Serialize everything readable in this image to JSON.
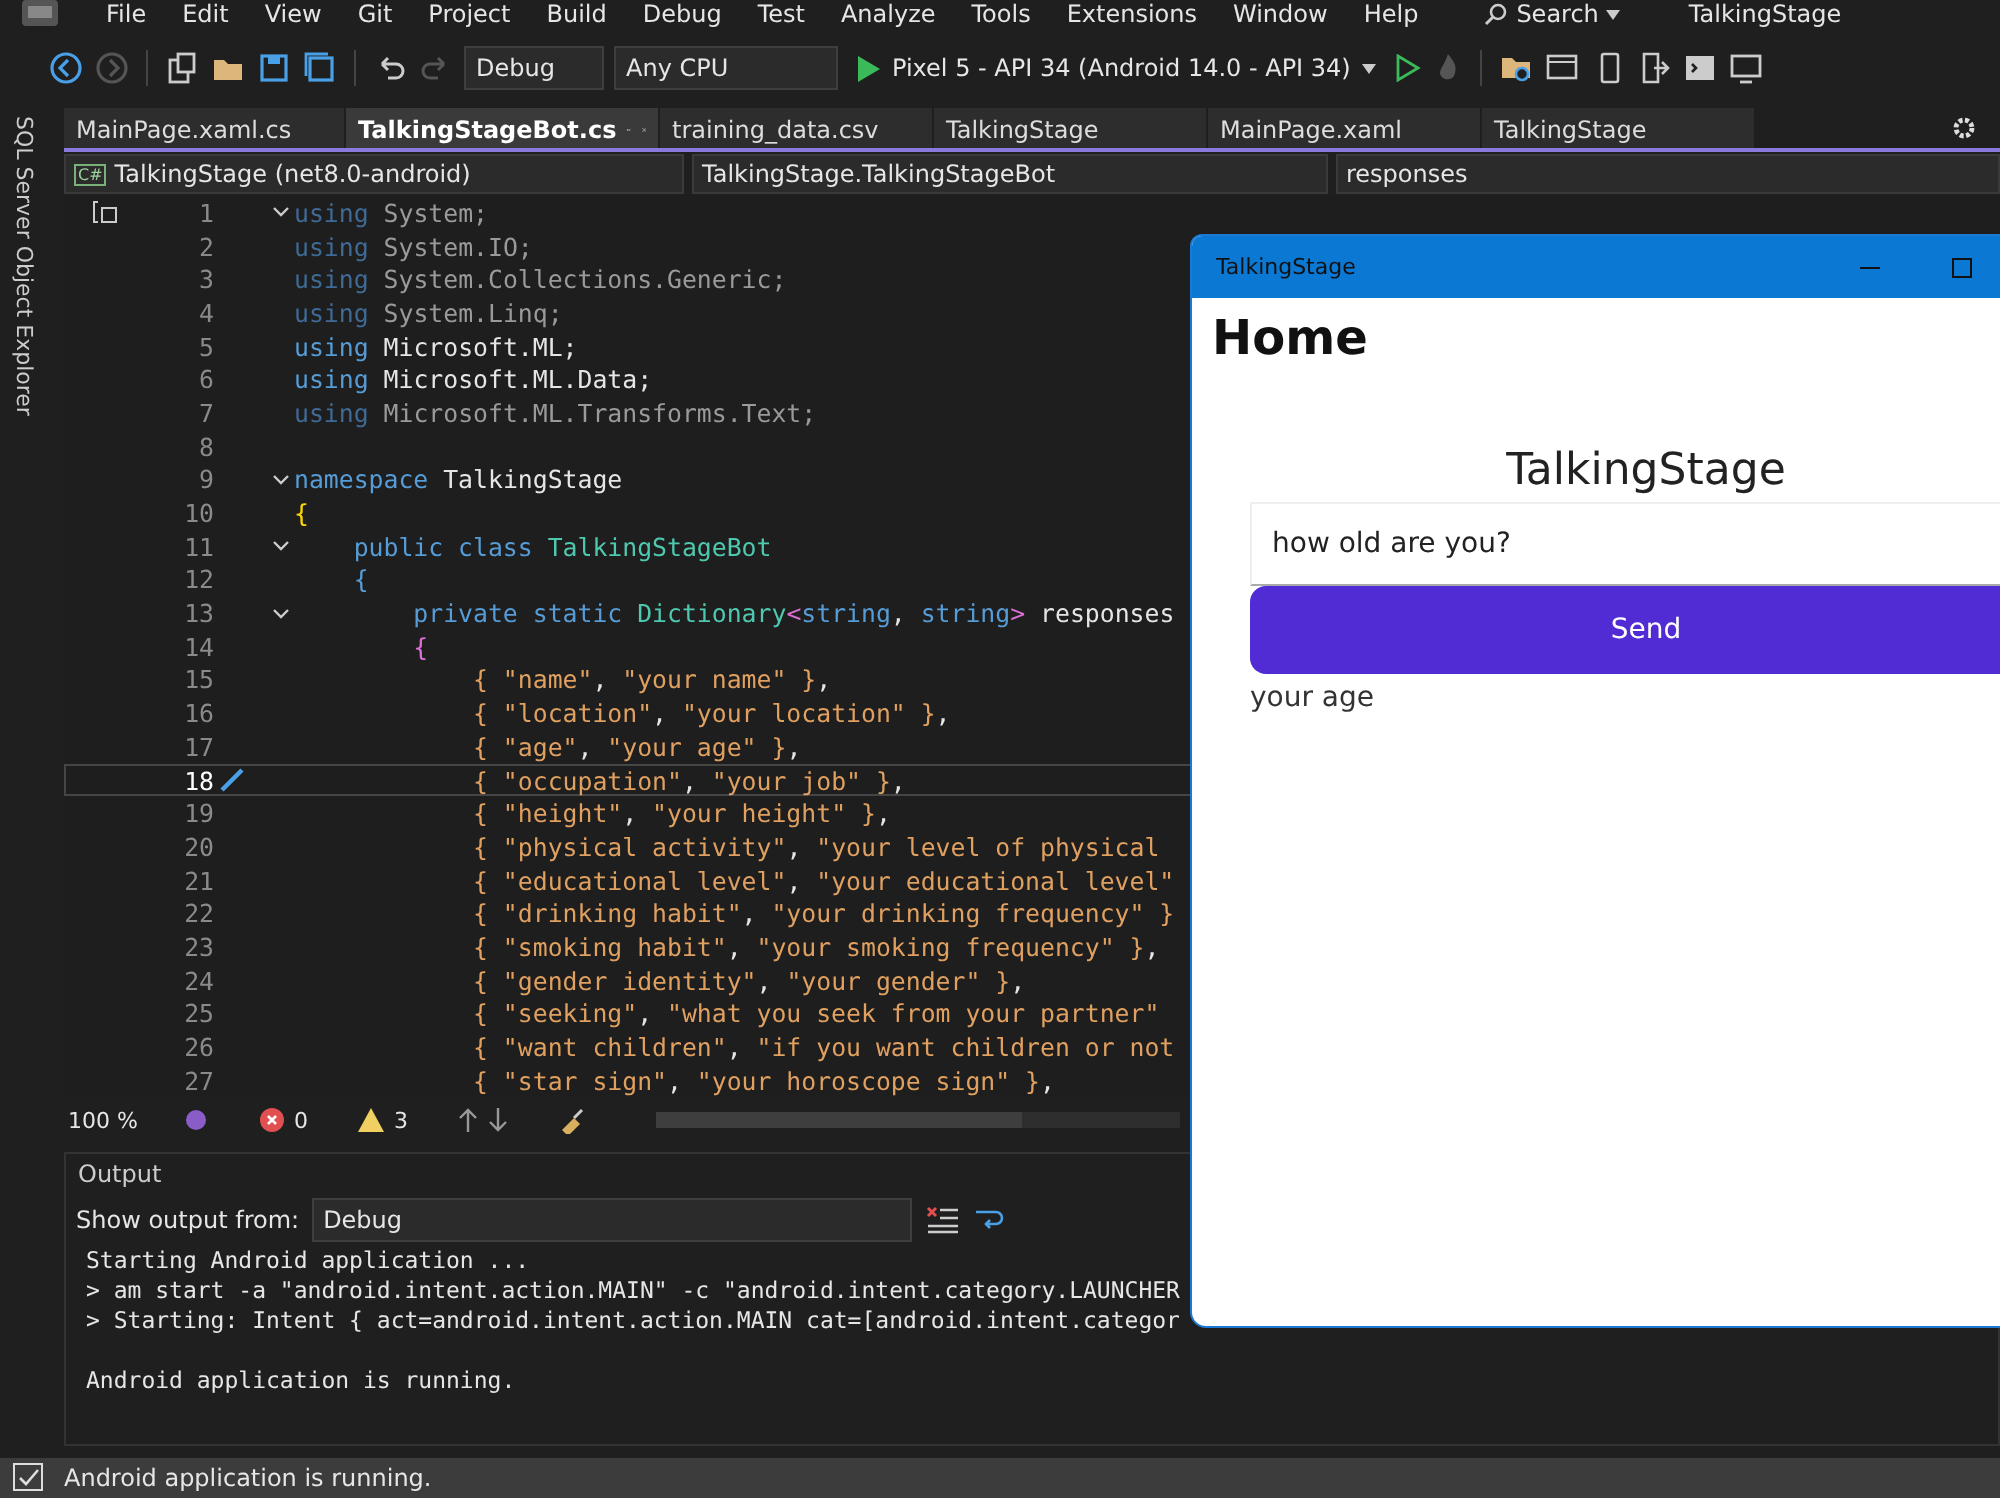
{
  "menu": [
    "File",
    "Edit",
    "View",
    "Git",
    "Project",
    "Build",
    "Debug",
    "Test",
    "Analyze",
    "Tools",
    "Extensions",
    "Window",
    "Help"
  ],
  "search": "Search",
  "solution_title": "TalkingStage",
  "toolbar": {
    "configuration": "Debug",
    "platform": "Any CPU",
    "run_target": "Pixel 5 - API 34 (Android 14.0 - API 34)"
  },
  "side_strip": "SQL Server Object Explorer",
  "tabs": [
    {
      "label": "MainPage.xaml.cs",
      "selected": false
    },
    {
      "label": "TalkingStageBot.cs",
      "selected": true
    },
    {
      "label": "training_data.csv",
      "selected": false
    },
    {
      "label": "TalkingStage",
      "selected": false
    },
    {
      "label": "MainPage.xaml",
      "selected": false
    },
    {
      "label": "TalkingStage",
      "selected": false
    }
  ],
  "nav_bar": {
    "project_icon_text": "C#",
    "project": "TalkingStage (net8.0-android)",
    "type": "TalkingStage.TalkingStageBot",
    "member": "responses"
  },
  "code_lines": [
    {
      "number": "1",
      "fold": true,
      "current": false,
      "tokens": [
        {
          "kind": "kwdim",
          "text": "using"
        },
        {
          "kind": "dim",
          "text": " System;"
        }
      ]
    },
    {
      "number": "2",
      "fold": false,
      "current": false,
      "tokens": [
        {
          "kind": "kwdim",
          "text": "using"
        },
        {
          "kind": "dim",
          "text": " System.IO;"
        }
      ]
    },
    {
      "number": "3",
      "fold": false,
      "current": false,
      "tokens": [
        {
          "kind": "kwdim",
          "text": "using"
        },
        {
          "kind": "dim",
          "text": " System.Collections.Generic;"
        }
      ]
    },
    {
      "number": "4",
      "fold": false,
      "current": false,
      "tokens": [
        {
          "kind": "kwdim",
          "text": "using"
        },
        {
          "kind": "dim",
          "text": " System.Linq;"
        }
      ]
    },
    {
      "number": "5",
      "fold": false,
      "current": false,
      "tokens": [
        {
          "kind": "kw",
          "text": "using"
        },
        {
          "kind": "plain",
          "text": " Microsoft.ML;"
        }
      ]
    },
    {
      "number": "6",
      "fold": false,
      "current": false,
      "tokens": [
        {
          "kind": "kw",
          "text": "using"
        },
        {
          "kind": "plain",
          "text": " Microsoft.ML.Data;"
        }
      ]
    },
    {
      "number": "7",
      "fold": false,
      "current": false,
      "tokens": [
        {
          "kind": "kwdim",
          "text": "using"
        },
        {
          "kind": "dim",
          "text": " Microsoft.ML.Transforms.Text;"
        }
      ]
    },
    {
      "number": "8",
      "fold": false,
      "current": false
    },
    {
      "number": "9",
      "fold": true,
      "current": false,
      "tokens": [
        {
          "kind": "kw",
          "text": "namespace"
        },
        {
          "kind": "plain",
          "text": " TalkingStage"
        }
      ]
    },
    {
      "number": "10",
      "fold": false,
      "current": false,
      "tokens": [
        {
          "kind": "brace1",
          "text": "{"
        }
      ]
    },
    {
      "number": "11",
      "fold": true,
      "current": false,
      "tokens": [
        {
          "kind": "kw",
          "text": "    public class"
        },
        {
          "kind": "type",
          "text": " TalkingStageBot"
        }
      ]
    },
    {
      "number": "12",
      "fold": false,
      "current": false,
      "tokens": [
        {
          "kind": "kw",
          "text": "    {"
        }
      ]
    },
    {
      "number": "13",
      "fold": true,
      "current": false,
      "tokens": [
        {
          "kind": "kw",
          "text": "        private static"
        },
        {
          "kind": "type",
          "text": " Dictionary"
        },
        {
          "kind": "brace3",
          "text": "<"
        },
        {
          "kind": "kw",
          "text": "string"
        },
        {
          "kind": "plain",
          "text": ", "
        },
        {
          "kind": "kw",
          "text": "string"
        },
        {
          "kind": "brace3",
          "text": ">"
        },
        {
          "kind": "plain",
          "text": " responses"
        }
      ]
    },
    {
      "number": "14",
      "fold": false,
      "current": false,
      "tokens": [
        {
          "kind": "brace3",
          "text": "        {"
        }
      ]
    },
    {
      "number": "15",
      "fold": false,
      "current": false,
      "tokens": [
        {
          "kind": "str",
          "text": "            { \"name\""
        },
        {
          "kind": "plain",
          "text": ", "
        },
        {
          "kind": "str",
          "text": "\"your name\" }"
        },
        {
          "kind": "plain",
          "text": ","
        }
      ]
    },
    {
      "number": "16",
      "fold": false,
      "current": false,
      "tokens": [
        {
          "kind": "str",
          "text": "            { \"location\""
        },
        {
          "kind": "plain",
          "text": ", "
        },
        {
          "kind": "str",
          "text": "\"your location\" }"
        },
        {
          "kind": "plain",
          "text": ","
        }
      ]
    },
    {
      "number": "17",
      "fold": false,
      "current": false,
      "tokens": [
        {
          "kind": "str",
          "text": "            { \"age\""
        },
        {
          "kind": "plain",
          "text": ", "
        },
        {
          "kind": "str",
          "text": "\"your age\" }"
        },
        {
          "kind": "plain",
          "text": ","
        }
      ]
    },
    {
      "number": "18",
      "fold": false,
      "current": true,
      "tokens": [
        {
          "kind": "str",
          "text": "            { \"occupation\""
        },
        {
          "kind": "plain",
          "text": ", "
        },
        {
          "kind": "str",
          "text": "\"your job\" }"
        },
        {
          "kind": "plain",
          "text": ","
        }
      ]
    },
    {
      "number": "19",
      "fold": false,
      "current": false,
      "tokens": [
        {
          "kind": "str",
          "text": "            { \"height\""
        },
        {
          "kind": "plain",
          "text": ", "
        },
        {
          "kind": "str",
          "text": "\"your height\" }"
        },
        {
          "kind": "plain",
          "text": ","
        }
      ]
    },
    {
      "number": "20",
      "fold": false,
      "current": false,
      "tokens": [
        {
          "kind": "str",
          "text": "            { \"physical activity\""
        },
        {
          "kind": "plain",
          "text": ", "
        },
        {
          "kind": "str",
          "text": "\"your level of physical"
        }
      ]
    },
    {
      "number": "21",
      "fold": false,
      "current": false,
      "tokens": [
        {
          "kind": "str",
          "text": "            { \"educational level\""
        },
        {
          "kind": "plain",
          "text": ", "
        },
        {
          "kind": "str",
          "text": "\"your educational level\""
        }
      ]
    },
    {
      "number": "22",
      "fold": false,
      "current": false,
      "tokens": [
        {
          "kind": "str",
          "text": "            { \"drinking habit\""
        },
        {
          "kind": "plain",
          "text": ", "
        },
        {
          "kind": "str",
          "text": "\"your drinking frequency\" }"
        }
      ]
    },
    {
      "number": "23",
      "fold": false,
      "current": false,
      "tokens": [
        {
          "kind": "str",
          "text": "            { \"smoking habit\""
        },
        {
          "kind": "plain",
          "text": ", "
        },
        {
          "kind": "str",
          "text": "\"your smoking frequency\" }"
        },
        {
          "kind": "plain",
          "text": ","
        }
      ]
    },
    {
      "number": "24",
      "fold": false,
      "current": false,
      "tokens": [
        {
          "kind": "str",
          "text": "            { \"gender identity\""
        },
        {
          "kind": "plain",
          "text": ", "
        },
        {
          "kind": "str",
          "text": "\"your gender\" }"
        },
        {
          "kind": "plain",
          "text": ","
        }
      ]
    },
    {
      "number": "25",
      "fold": false,
      "current": false,
      "tokens": [
        {
          "kind": "str",
          "text": "            { \"seeking\""
        },
        {
          "kind": "plain",
          "text": ", "
        },
        {
          "kind": "str",
          "text": "\"what you seek from your partner\""
        }
      ]
    },
    {
      "number": "26",
      "fold": false,
      "current": false,
      "tokens": [
        {
          "kind": "str",
          "text": "            { \"want children\""
        },
        {
          "kind": "plain",
          "text": ", "
        },
        {
          "kind": "str",
          "text": "\"if you want children or not"
        }
      ]
    },
    {
      "number": "27",
      "fold": false,
      "current": false,
      "tokens": [
        {
          "kind": "str",
          "text": "            { \"star sign\""
        },
        {
          "kind": "plain",
          "text": ", "
        },
        {
          "kind": "str",
          "text": "\"your horoscope sign\" }"
        },
        {
          "kind": "plain",
          "text": ","
        }
      ]
    }
  ],
  "editor_status": {
    "zoom": "100 %",
    "errors": "0",
    "warnings": "3"
  },
  "output": {
    "title": "Output",
    "source_label": "Show output from:",
    "source": "Debug",
    "lines": [
      {
        "text": "Starting Android application ...",
        "gap_before": false
      },
      {
        "text": "> am start -a \"android.intent.action.MAIN\" -c \"android.intent.category.LAUNCHER",
        "gap_before": false
      },
      {
        "text": "> Starting: Intent { act=android.intent.action.MAIN cat=[android.intent.categor",
        "gap_before": false
      },
      {
        "text": "Android application is running.",
        "gap_before": true
      }
    ]
  },
  "status_bar": "Android application is running.",
  "app_window": {
    "title": "TalkingStage",
    "page_title": "Home",
    "heading": "TalkingStage",
    "entry_value": "how old are you?",
    "button": "Send",
    "result": "your age"
  }
}
